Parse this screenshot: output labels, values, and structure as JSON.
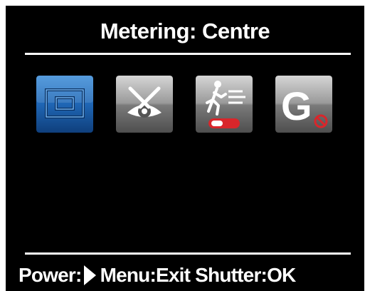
{
  "header": {
    "title": "Metering: Centre"
  },
  "options": [
    {
      "id": "centre",
      "icon": "centre-weighted-metering-icon",
      "selected": true,
      "color": "#1e5fae"
    },
    {
      "id": "anti-shake",
      "icon": "eye-crosshair-icon",
      "selected": false,
      "color": "#8c8c8c"
    },
    {
      "id": "motion-detect",
      "icon": "running-person-toggle-icon",
      "selected": false,
      "color": "#8c8c8c"
    },
    {
      "id": "g-sensor",
      "icon": "g-sensor-off-icon",
      "selected": false,
      "color": "#8c8c8c"
    }
  ],
  "footer": {
    "power_label": "Power:",
    "power_icon": "play-arrow-icon",
    "menu_label": "Menu:",
    "menu_action": "Exit",
    "shutter_label": "Shutter:",
    "shutter_action": "OK"
  },
  "colors": {
    "background": "#000000",
    "text": "#ffffff",
    "selected": "#1e5fae",
    "unselected": "#8c8c8c",
    "accent_red": "#d9262b"
  }
}
